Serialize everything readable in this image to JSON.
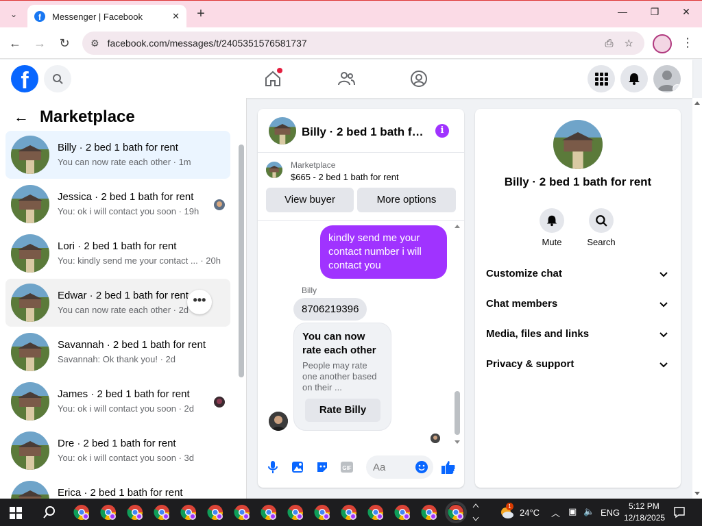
{
  "browser": {
    "tab_title": "Messenger | Facebook",
    "url": "facebook.com/messages/t/2405351576581737",
    "new_tab_label": "+",
    "tab_close": "✕"
  },
  "sidebar": {
    "title": "Marketplace",
    "conversations": [
      {
        "name": "Billy · 2 bed 1 bath for rent",
        "snippet": "You can now rate each other · 1m"
      },
      {
        "name": "Jessica · 2 bed 1 bath for rent",
        "snippet": "You: ok i will contact you soon · 19h"
      },
      {
        "name": "Lori · 2 bed 1 bath for rent",
        "snippet": "You: kindly send me your contact ... · 20h"
      },
      {
        "name": "Edwar · 2 bed 1 bath for rent",
        "snippet": "You can now rate each other · 2d"
      },
      {
        "name": "Savannah · 2 bed 1 bath for rent",
        "snippet": "Savannah: Ok thank you! · 2d"
      },
      {
        "name": "James · 2 bed 1 bath for rent",
        "snippet": "You: ok i will contact you soon · 2d"
      },
      {
        "name": "Dre · 2 bed 1 bath for rent",
        "snippet": "You: ok i will contact you soon · 3d"
      },
      {
        "name": "Erica · 2 bed 1 bath for rent",
        "snippet": ""
      }
    ],
    "more_label": "•••"
  },
  "chat": {
    "header_name": "Billy · 2 bed 1 bath fo...",
    "listing_category": "Marketplace",
    "listing_desc": "$665 - 2 bed 1 bath for rent",
    "view_buyer": "View buyer",
    "more_options": "More options",
    "outgoing": "kindly send me your contact number i will contact you",
    "sender_name": "Billy",
    "incoming": "8706219396",
    "card_title": "You can now rate each other",
    "card_body": "People may rate one another based on their ...",
    "rate_button": "Rate Billy",
    "composer_placeholder": "Aa"
  },
  "info": {
    "name": "Billy · 2 bed 1 bath for rent",
    "mute_label": "Mute",
    "search_label": "Search",
    "sections": [
      "Customize chat",
      "Chat members",
      "Media, files and links",
      "Privacy & support"
    ]
  },
  "taskbar": {
    "temp": "24°C",
    "lang": "ENG",
    "time": "5:12 PM",
    "date": "12/18/2025",
    "weather_badge": "1"
  },
  "colors": {
    "accent_purple": "#a033ff",
    "fb_blue": "#0866ff",
    "tab_bar": "#fbdbe6"
  }
}
